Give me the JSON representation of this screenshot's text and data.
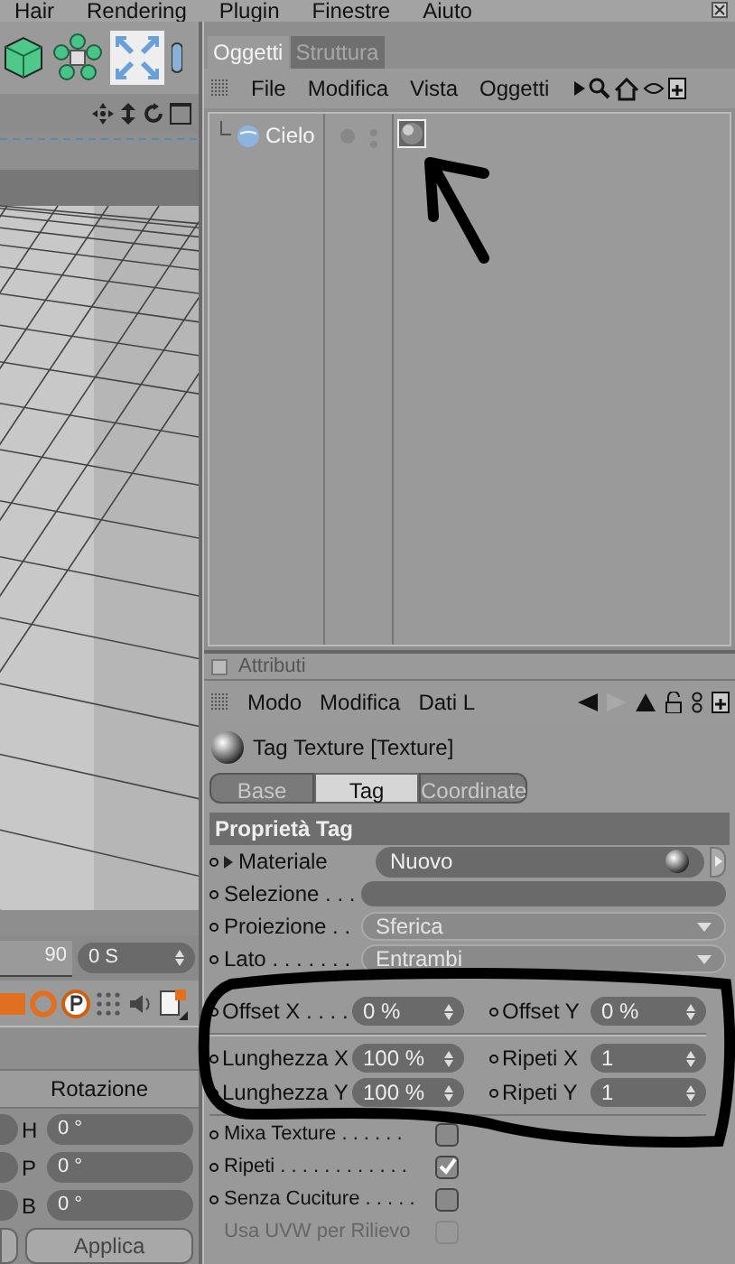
{
  "menu_bar": [
    "Hair",
    "Rendering",
    "Plugin",
    "Finestre",
    "Aiuto"
  ],
  "viewport": {
    "timeline_value": "90",
    "time_field": "0 S"
  },
  "coordinates": {
    "header": "Rotazione",
    "rows": [
      {
        "axis": "H",
        "value": "0 °"
      },
      {
        "axis": "P",
        "value": "0 °"
      },
      {
        "axis": "B",
        "value": "0 °"
      }
    ],
    "apply_button": "Applica"
  },
  "object_manager": {
    "tabs": [
      {
        "label": "Oggetti",
        "selected": true
      },
      {
        "label": "Struttura",
        "selected": false
      }
    ],
    "menu": [
      "File",
      "Modifica",
      "Vista",
      "Oggetti"
    ],
    "objects": [
      {
        "name": "Cielo"
      }
    ]
  },
  "attributes": {
    "panel_checkbox": {
      "checked": false
    },
    "title": "Attributi",
    "menu": [
      "Modo",
      "Modifica",
      "Dati L"
    ],
    "object_title": "Tag Texture [Texture]",
    "tabs": [
      {
        "label": "Base",
        "selected": false
      },
      {
        "label": "Tag",
        "selected": true
      },
      {
        "label": "Coordinate",
        "selected": false
      }
    ],
    "section": "Proprietà Tag",
    "fields": [
      {
        "kind": "link",
        "label": "Materiale",
        "value": "Nuovo"
      },
      {
        "kind": "text",
        "label": "Selezione . . ."
      },
      {
        "kind": "dropdown",
        "label": "Proiezione . .",
        "value": "Sferica"
      },
      {
        "kind": "dropdown",
        "label": "Lato . . . . . . .",
        "value": "Entrambi"
      }
    ],
    "pair_groups": [
      [
        [
          {
            "label": "Offset X . . . .",
            "value": "0 %"
          },
          {
            "label": "Offset Y",
            "value": "0 %"
          }
        ]
      ],
      [
        [
          {
            "label": "Lunghezza X",
            "value": "100 %"
          },
          {
            "label": "Ripeti X",
            "value": "1"
          }
        ],
        [
          {
            "label": "Lunghezza Y",
            "value": "100 %"
          },
          {
            "label": "Ripeti Y",
            "value": "1"
          }
        ]
      ]
    ],
    "checkboxes": [
      {
        "label": "Mixa Texture . . . . . .",
        "checked": false,
        "disabled": false
      },
      {
        "label": "Ripeti . . . . . . . . . . . .",
        "checked": true,
        "disabled": false
      },
      {
        "label": "Senza Cuciture . . . . .",
        "checked": false,
        "disabled": false
      },
      {
        "label": "Usa UVW per Rilievo",
        "checked": false,
        "disabled": true
      }
    ]
  }
}
